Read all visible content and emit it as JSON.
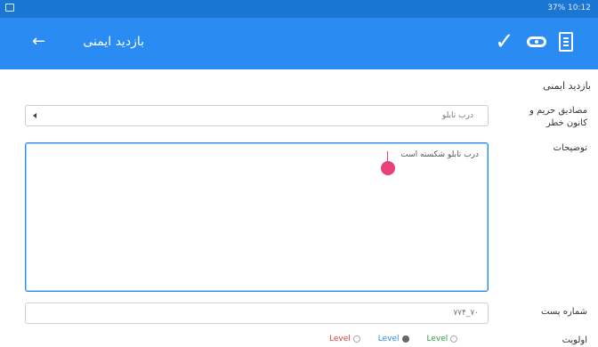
{
  "status_bar": {
    "left_icon": "screenshot-icon",
    "right_text": "37% 10:12",
    "icons": [
      "location-icon",
      "wifi-icon",
      "signal-icon",
      "battery-icon"
    ]
  },
  "app_bar": {
    "title": "بازدید ایمنی",
    "back_icon": "arrow-left-icon",
    "actions": [
      "check-icon",
      "link-icon",
      "document-icon"
    ]
  },
  "form": {
    "section_title": "بازدید ایمنی",
    "field_hazard": {
      "label": "مصادیق حریم و کانون خطر",
      "value": "درب تابلو"
    },
    "field_description": {
      "label": "توضیحات",
      "value": "درب تابلو شکسته است"
    },
    "field_post_number": {
      "label": "شماره پست",
      "value": "۷۰_۷۷۴"
    },
    "field_priority": {
      "label": "اولویت",
      "options": [
        {
          "label": "Level",
          "checked": false,
          "color": "#2e9e3e"
        },
        {
          "label": "Level",
          "checked": true,
          "color": "#2a8bf2"
        },
        {
          "label": "Level",
          "checked": false,
          "color": "#e53935"
        }
      ]
    }
  },
  "colors": {
    "status_bar": "#1976d2",
    "app_bar": "#2a8bf2",
    "accent_cursor": "#e9427a"
  }
}
